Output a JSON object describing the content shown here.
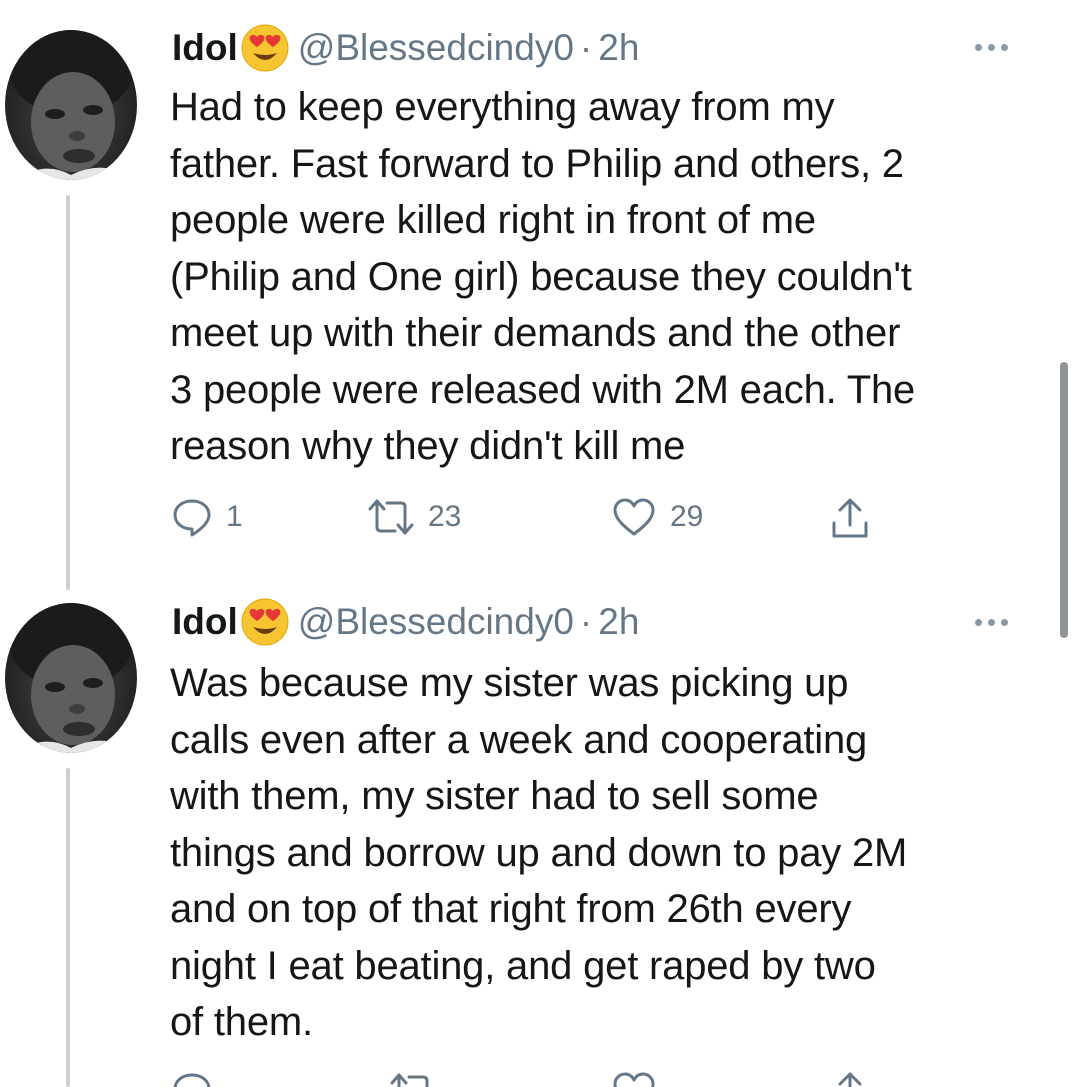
{
  "tweets": [
    {
      "display_name": "Idol",
      "emoji_icon": "heart-eyes-emoji",
      "handle": "@Blessedcindy0",
      "separator": "·",
      "time": "2h",
      "lines": [
        "Had to keep everything away from my",
        "father. Fast forward to Philip and others, 2",
        "people were killed right in front of me",
        "(Philip and One girl) because they couldn't",
        "meet up with their demands and the other",
        "3 people were released with 2M each. The",
        "reason why they didn't kill me"
      ],
      "reply_count": "1",
      "retweet_count": "23",
      "like_count": "29"
    },
    {
      "display_name": "Idol",
      "emoji_icon": "heart-eyes-emoji",
      "handle": "@Blessedcindy0",
      "separator": "·",
      "time": "2h",
      "lines": [
        "Was because my sister was picking up",
        "calls even after a week and cooperating",
        "with them, my sister had to sell some",
        "things and borrow up and down to pay 2M",
        "and on top of that right from 26th every",
        "night I eat beating, and get raped by two",
        "of them."
      ]
    }
  ],
  "icons": {
    "reply": "reply-icon",
    "retweet": "retweet-icon",
    "like": "heart-icon",
    "share": "share-icon",
    "more": "more-icon"
  },
  "colors": {
    "text": "#14171a",
    "secondary": "#657786",
    "thread_line": "#c8d0d6"
  }
}
